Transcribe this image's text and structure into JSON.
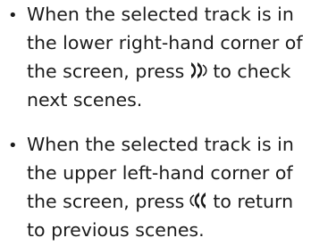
{
  "bullets": [
    {
      "marker": "•",
      "line1": "When the selected track is in",
      "line2": "the lower right-hand corner of",
      "line3_before_icon": "the screen, press",
      "icon": "fast-forward-scan-icon",
      "line3_after_icon": "to check",
      "line4": "next scenes."
    },
    {
      "marker": "•",
      "line1": "When the selected track is in",
      "line2": "the upper left-hand corner of",
      "line3_before_icon": "the screen, press",
      "icon": "rewind-scan-icon",
      "line3_after_icon": "to return",
      "line4": "to previous scenes."
    }
  ],
  "colors": {
    "text": "#1c1c1c",
    "background": "#ffffff"
  }
}
